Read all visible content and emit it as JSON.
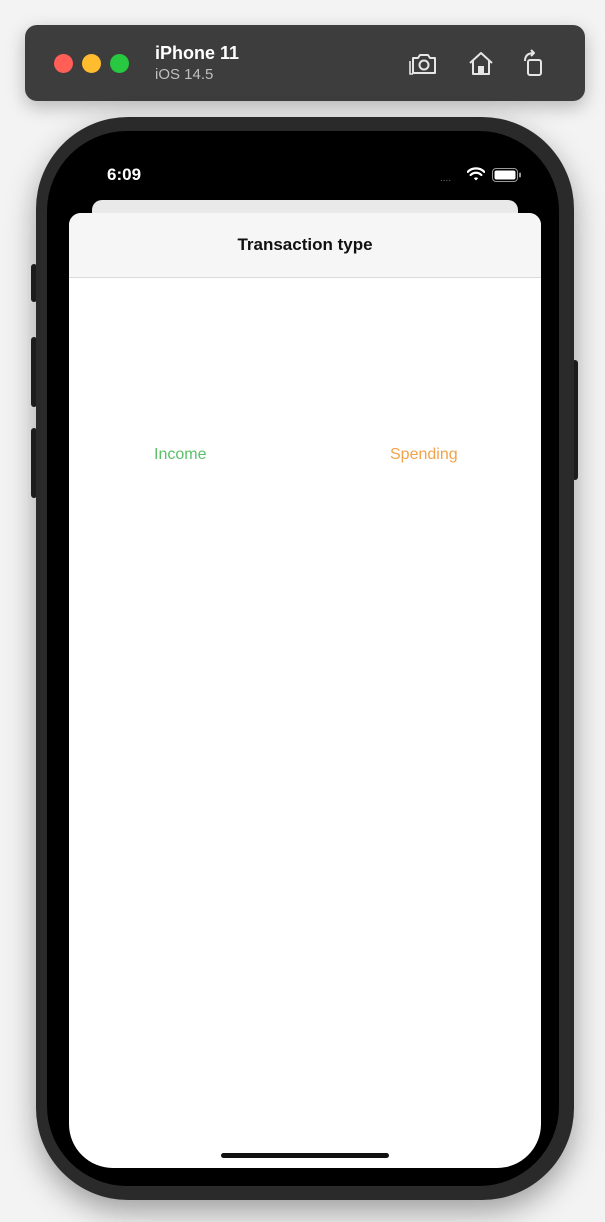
{
  "simulator": {
    "device_name": "iPhone 11",
    "os_version": "iOS 14.5",
    "icons": [
      "screenshot-icon",
      "home-icon",
      "rotate-icon"
    ]
  },
  "status_bar": {
    "time": "6:09",
    "signal": "....",
    "icons": [
      "wifi-icon",
      "battery-icon"
    ]
  },
  "sheet": {
    "title": "Transaction type",
    "options": [
      {
        "label": "Income",
        "color": "#5bbf6a"
      },
      {
        "label": "Spending",
        "color": "#f0a34a"
      }
    ]
  }
}
